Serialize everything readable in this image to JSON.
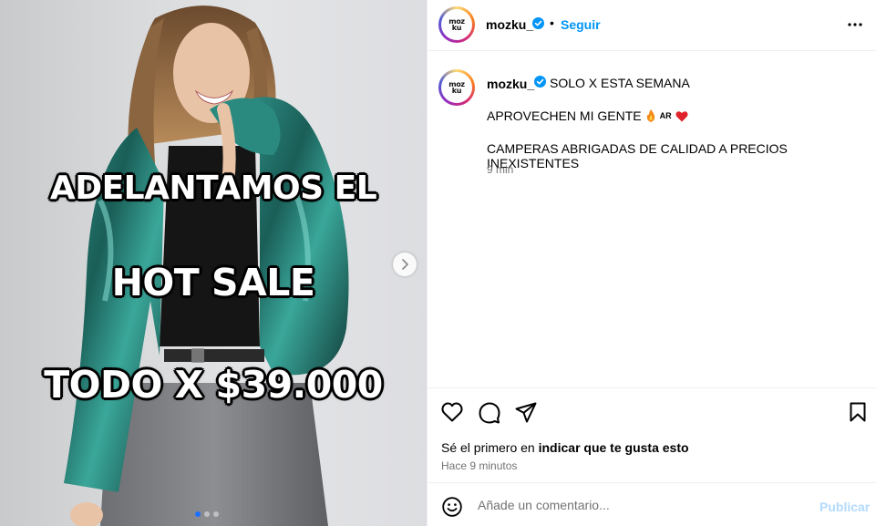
{
  "media": {
    "overlay_lines": [
      "ADELANTAMOS EL",
      "HOT SALE",
      "TODO X $39.000"
    ],
    "carousel": {
      "total": 3,
      "active": 1
    }
  },
  "header": {
    "username": "mozku_",
    "separator": "•",
    "follow_label": "Seguir",
    "avatar_text": [
      "moz",
      "ku"
    ]
  },
  "caption": {
    "username": "mozku_",
    "line1": "SOLO X ESTA SEMANA",
    "line2": "APROVECHEN MI GENTE",
    "line2_flag": "AR",
    "line3": "CAMPERAS ABRIGADAS DE CALIDAD A PRECIOS INEXISTENTES",
    "time": "9 min"
  },
  "stats": {
    "likes_prefix": "Sé el primero en ",
    "likes_bold": "indicar que te gusta esto",
    "posted_ago": "Hace 9 minutos"
  },
  "comment": {
    "placeholder": "Añade un comentario...",
    "publish_label": "Publicar"
  },
  "colors": {
    "link_blue": "#0095f6",
    "verified_blue": "#0095f6",
    "publish_disabled": "#b3dbff",
    "muted_text": "#737373",
    "jacket_teal": "#1f6b62"
  }
}
